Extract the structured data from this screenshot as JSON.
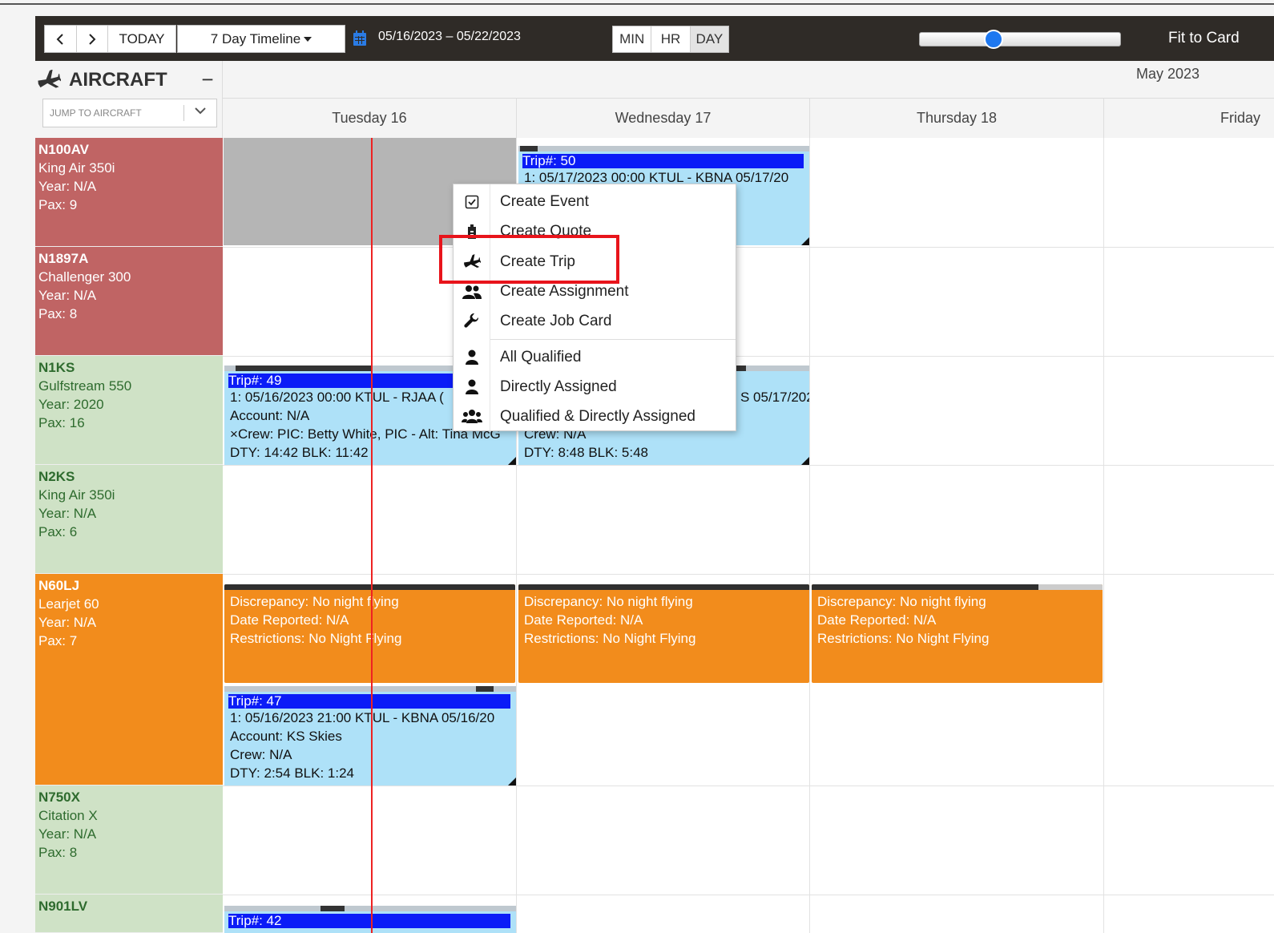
{
  "toolbar": {
    "today_label": "TODAY",
    "view_label": "7 Day Timeline",
    "date_range": "05/16/2023 – 05/22/2023",
    "zoom": [
      "MIN",
      "HR",
      "DAY"
    ],
    "zoom_active": "DAY",
    "zoom_slider_value": 0.35,
    "fit_label": "Fit to Card"
  },
  "sidebar": {
    "title": "AIRCRAFT",
    "jump_placeholder": "JUMP TO AIRCRAFT"
  },
  "calendar": {
    "month": "May 2023",
    "days": [
      "Tuesday 16",
      "Wednesday 17",
      "Thursday 18",
      "Friday"
    ]
  },
  "aircraft": [
    {
      "tail": "N100AV",
      "model": "King Air 350i",
      "year": "Year: N/A",
      "pax": "Pax: 9",
      "color": "#c06464",
      "text_color": "#ffffff"
    },
    {
      "tail": "N1897A",
      "model": "Challenger 300",
      "year": "Year: N/A",
      "pax": "Pax: 8",
      "color": "#c06464",
      "text_color": "#ffffff"
    },
    {
      "tail": "N1KS",
      "model": "Gulfstream 550",
      "year": "Year: 2020",
      "pax": "Pax: 16",
      "color": "#cfe2c6",
      "text_color": "#2e6b2e"
    },
    {
      "tail": "N2KS",
      "model": "King Air 350i",
      "year": "Year: N/A",
      "pax": "Pax: 6",
      "color": "#cfe2c6",
      "text_color": "#2e6b2e"
    },
    {
      "tail": "N60LJ",
      "model": "Learjet 60",
      "year": "Year: N/A",
      "pax": "Pax: 7",
      "color": "#f28c1c",
      "text_color": "#2e6b2e"
    },
    {
      "tail": "N750X",
      "model": "Citation X",
      "year": "Year: N/A",
      "pax": "Pax: 8",
      "color": "#cfe2c6",
      "text_color": "#2e6b2e"
    },
    {
      "tail": "N901LV",
      "model": "",
      "year": "",
      "pax": "",
      "color": "#cfe2c6",
      "text_color": "#2e6b2e"
    }
  ],
  "trips": {
    "t50": {
      "header": "Trip#: 50",
      "line1": "1: 05/17/2023 00:00 KTUL - KBNA 05/17/20"
    },
    "t49": {
      "header": "Trip#: 49",
      "line1": "1: 05/16/2023 00:00 KTUL - RJAA (",
      "account": "Account: N/A",
      "crew": "Crew: PIC: Betty White, PIC - Alt: Tina McG",
      "duty": "DTY: 14:42 BLK: 11:42"
    },
    "t49b": {
      "line1": "S 05/17/202",
      "crew": "Crew: N/A",
      "duty": "DTY: 8:48 BLK: 5:48"
    },
    "t47": {
      "header": "Trip#: 47",
      "line1": "1: 05/16/2023 21:00 KTUL - KBNA 05/16/20",
      "account": "Account: KS Skies",
      "crew": "Crew: N/A",
      "duty": "DTY: 2:54 BLK: 1:24"
    },
    "t42": {
      "header": "Trip#: 42"
    }
  },
  "discrepancy": {
    "line1": "Discrepancy: No night flying",
    "line2": "Date Reported: N/A",
    "line3": "Restrictions: No Night Flying"
  },
  "context_menu": {
    "items": [
      "Create Event",
      "Create Quote",
      "Create Trip",
      "Create Assignment",
      "Create Job Card",
      "All Qualified",
      "Directly Assigned",
      "Qualified & Directly Assigned"
    ]
  },
  "colors": {
    "trip_header": "#0b1cf7",
    "trip_body": "#aee1f8",
    "discrepancy": "#f28c1c",
    "now_line": "#e22222",
    "highlight": "#e8141b"
  }
}
